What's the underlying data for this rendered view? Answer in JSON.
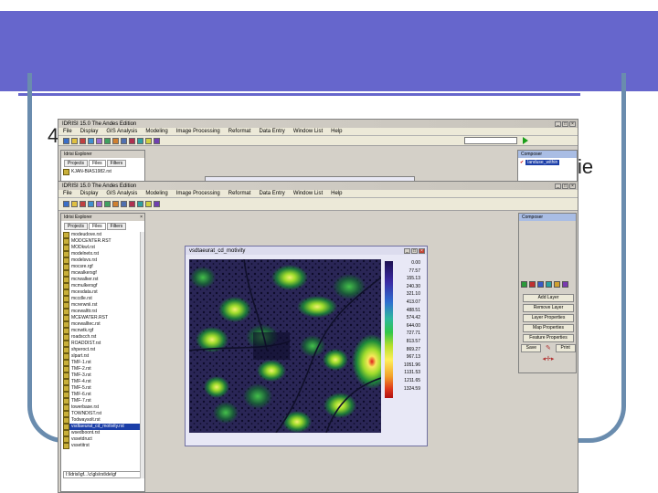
{
  "slide": {
    "bullet_prefix": "4",
    "right_fragment": "ie"
  },
  "back_window": {
    "title": "IDRISI 15.0  The Andes Edition",
    "menus": [
      "File",
      "Display",
      "GIS Analysis",
      "Modeling",
      "Image Processing",
      "Reformat",
      "Data Entry",
      "Window List",
      "Help"
    ],
    "explorer_title": "Idrisi Explorer",
    "tabs": [
      "Projects",
      "Files",
      "Filters"
    ],
    "first_file": "KJAN-BIAS1982.rst",
    "composer_title": "Composer",
    "composer_item": "landuse_within"
  },
  "front_window": {
    "title": "IDRISI 15.0  The Andes Edition",
    "menus": [
      "File",
      "Display",
      "GIS Analysis",
      "Modeling",
      "Image Processing",
      "Reformat",
      "Data Entry",
      "Window List",
      "Help"
    ],
    "explorer_title": "Idrisi Explorer",
    "tabs": [
      "Projects",
      "Files",
      "Filters"
    ],
    "files": [
      "modeudove.rst",
      "MODCENTER.RST",
      "MODkwl.rst",
      "modelnetx.rst",
      "modelsvs.rst",
      "mocsre.rgf",
      "mcwalkersgf",
      "mcrwalker.rst",
      "mcmulkersgf",
      "mcesdata.rst",
      "mccdle.rst",
      "mcrerwnii.rst",
      "mcewalttr.rst",
      "MCEWATER.RST",
      "mcewalltec.rst",
      "mcnwtk.rgf",
      "roadscch.rst",
      "ROADDIST.rst",
      "shperoct.rst",
      "slpart.rst",
      "TMF-1.rst",
      "TMF-2.rst",
      "TMF-3.rst",
      "TMF-4.rst",
      "TMF-5.rst",
      "TMF-6.rst",
      "TMF-7.rst",
      "towerbase.rst",
      "TOWNDIST.rst",
      "Todwaysolt.rst",
      "vsdtaeurat_cd_motivity.rst",
      "wsedboont.rst",
      "vssetdruct",
      "vssetitrst"
    ],
    "selected_index": 30,
    "bottom_path": "I:\\ldrisi\\gf...\\c\\gls\\rst\\de\\gf",
    "map_window_title": "vsdtaeurat_cd_motivity",
    "legend_values": [
      "0.00",
      "77.57",
      "155.13",
      "240.30",
      "321.10",
      "413.07",
      "488.51",
      "574.42",
      "644.00",
      "727.71",
      "813.57",
      "869.27",
      "967.13",
      "1051.96",
      "1131.53",
      "1211.65",
      "1324.59"
    ],
    "composer_title": "Composer",
    "composer_buttons": [
      "Add Layer",
      "Remove Layer",
      "Layer Properties",
      "Map Properties",
      "Feature Properties"
    ],
    "save_label": "Save",
    "print_label": "Print"
  },
  "colors": {
    "banner": "#6666cc",
    "frame": "#6a8cae",
    "legend_gradient": [
      "#1c1050",
      "#3b2aa3",
      "#2e6fd0",
      "#2eb89e",
      "#31c64a",
      "#b7e02c",
      "#fff05a",
      "#f3a22a",
      "#e03a1b",
      "#b01012"
    ]
  }
}
